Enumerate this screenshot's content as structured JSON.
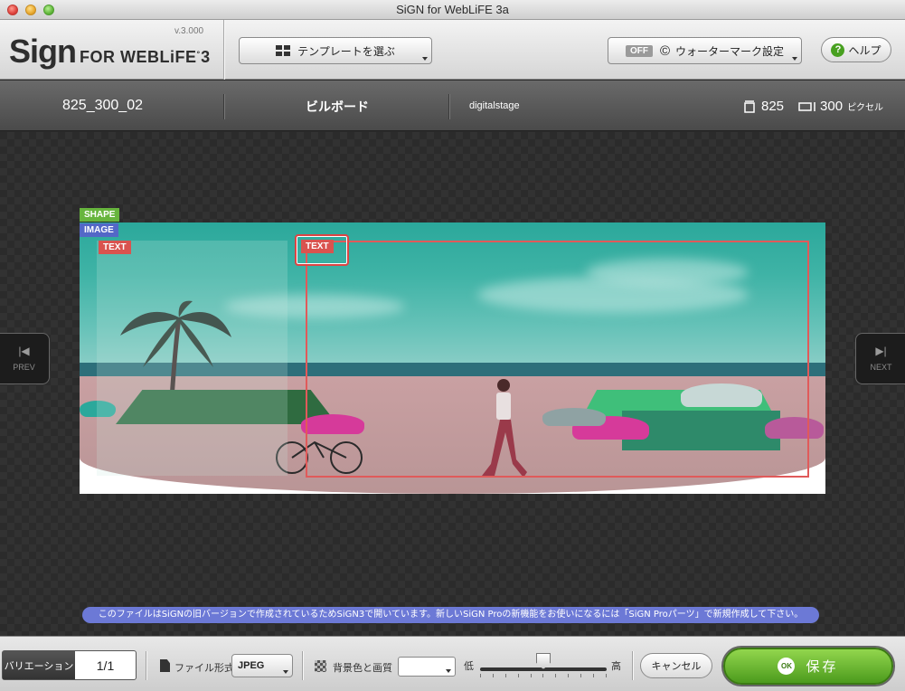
{
  "window": {
    "title": "SiGN for WebLiFE 3a"
  },
  "logo": {
    "main": "Sign",
    "sub": "FOR WEBLiFE",
    "edition": "3",
    "version": "v.3.000"
  },
  "toolbar": {
    "template_label": "テンプレートを選ぶ",
    "watermark_state": "OFF",
    "watermark_label": "ウォーターマーク設定",
    "help_label": "ヘルプ"
  },
  "info": {
    "template_name": "825_300_02",
    "category": "ビルボード",
    "author": "digitalstage",
    "width": "825",
    "height": "300",
    "unit": "ピクセル"
  },
  "canvas": {
    "tags": {
      "shape": "SHAPE",
      "image": "IMAGE",
      "text1": "TEXT",
      "text2": "TEXT"
    }
  },
  "nav": {
    "prev": "PREV",
    "next": "NEXT"
  },
  "notice": "このファイルはSiGNの旧バージョンで作成されているためSiGN3で開いています。新しいSiGN Proの新機能をお使いになるには「SiGN Proパーツ」で新規作成して下さい。",
  "bottom": {
    "variation_label": "バリエーション",
    "variation_count": "1/1",
    "file_format_label": "ファイル形式",
    "file_format_value": "JPEG",
    "bg_quality_label": "背景色と画質",
    "quality_low": "低",
    "quality_high": "高",
    "quality_level": 0.5,
    "cancel_label": "キャンセル",
    "save_ok": "OK",
    "save_label": "保存"
  }
}
